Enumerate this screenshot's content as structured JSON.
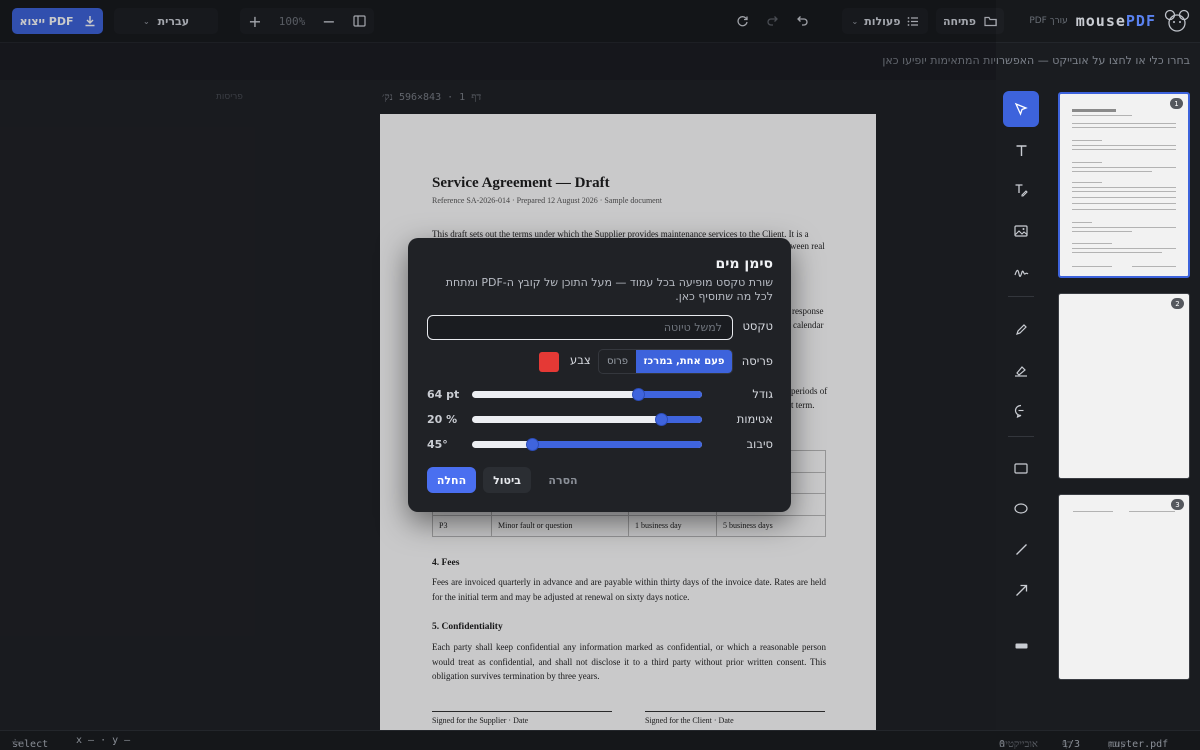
{
  "app": {
    "name_prefix": "mouse",
    "name_suffix": "PDF",
    "subtitle": "עורך PDF"
  },
  "toolbar": {
    "export_label": "ייצוא PDF",
    "language": "עברית",
    "zoom_value": "100%",
    "actions_label": "פעולות",
    "open_label": "פתיחה"
  },
  "hint": "בחרו כלי או לחצו על אובייקט — האפשרויות המתאימות יופיעו כאן",
  "canvas": {
    "side_label": "פריסות",
    "page_info": "דף 1 · 843×596 נק׳"
  },
  "document": {
    "title": "Service Agreement — Draft",
    "reference": "Reference SA-2026-014 · Prepared 12 August 2026 · Sample document",
    "intro_visible": "This draft sets out the terms under which the Supplier provides maintenance services to the Client. It is a",
    "intro_right_fragment": "ween real",
    "response_fragment": "response",
    "calendar_fragment": "calendar",
    "periods_fragment": "periods of",
    "term_fragment": "t term.",
    "table_rows": [
      {
        "code": "P3",
        "desc": "Minor fault or question",
        "resp": "1 business day",
        "res": "5 business days"
      }
    ],
    "fees_heading": "4. Fees",
    "fees_text": "Fees are invoiced quarterly in advance and are payable within thirty days of the invoice date. Rates are held for the initial term and may be adjusted at renewal on sixty days notice.",
    "conf_heading": "5. Confidentiality",
    "conf_text": "Each party shall keep confidential any information marked as confidential, or which a reasonable person would treat as confidential, and shall not disclose it to a third party without prior written consent. This obligation survives termination by three years.",
    "sig_supplier": "Signed for the Supplier · Date",
    "sig_client": "Signed for the Client · Date"
  },
  "watermark_dialog": {
    "title": "סימן מים",
    "description": "שורת טקסט מופיעה בכל עמוד — מעל התוכן של קובץ ה-PDF ומתחת לכל מה שתוסיף כאן.",
    "text_label": "טקסט",
    "text_placeholder": "למשל טיוטה",
    "text_value": "",
    "layout_label": "פריסה",
    "layout_options": [
      "פעם אחת, במרכז",
      "פרוס"
    ],
    "layout_selected": "פעם אחת, במרכז",
    "color_label": "צבע",
    "color_value": "#e53935",
    "size_label": "גודל",
    "size_display": "64 pt",
    "size_fraction": 0.28,
    "opacity_label": "אטימות",
    "opacity_display": "20 %",
    "opacity_fraction": 0.18,
    "rotation_label": "סיבוב",
    "rotation_display": "45°",
    "rotation_fraction": 0.74,
    "apply_label": "החלה",
    "cancel_label": "ביטול",
    "remove_label": "הסרה"
  },
  "thumbnails": [
    {
      "number": "1",
      "selected": true
    },
    {
      "number": "2",
      "selected": false
    },
    {
      "number": "3",
      "selected": false
    }
  ],
  "tools": [
    "select-icon",
    "text-icon",
    "edit-text-icon",
    "image-icon",
    "signature-icon",
    "pen-icon",
    "highlighter-icon",
    "comment-icon",
    "rectangle-icon",
    "ellipse-icon",
    "line-icon",
    "arrow-icon",
    "redact-icon"
  ],
  "status": {
    "file_label": "קובץ",
    "file_name": "muster.pdf",
    "page_label": "דף",
    "page_value": "1/3",
    "objects_label": "אובייקטים",
    "objects_value": "0",
    "tool_value": "select",
    "tool_label": "כלי",
    "coords": "x — · y —"
  },
  "colors": {
    "accent": "#3d63dc",
    "watermark": "#e53935"
  }
}
